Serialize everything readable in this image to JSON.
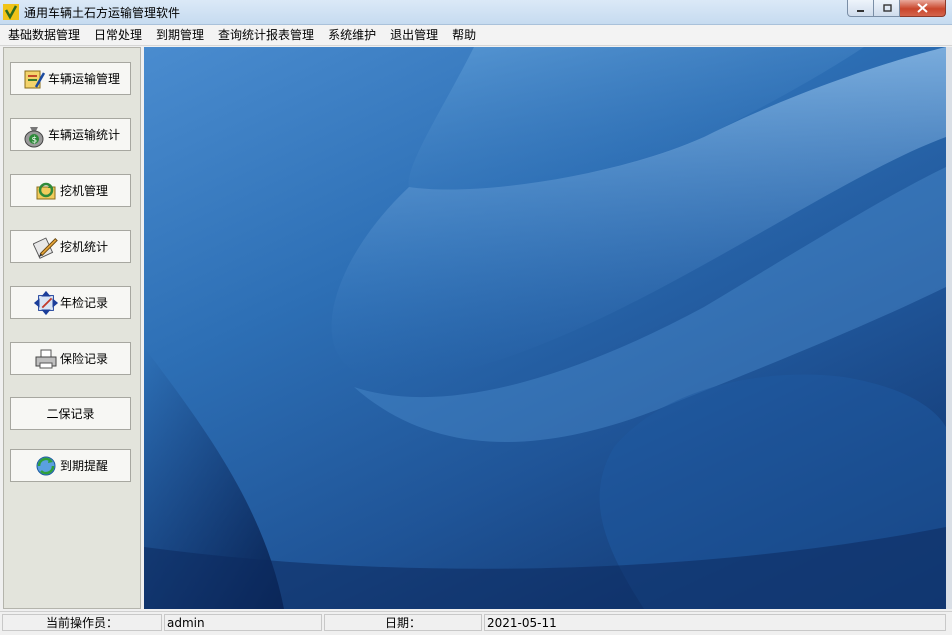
{
  "window": {
    "title": "通用车辆土石方运输管理软件"
  },
  "menubar": {
    "items": [
      "基础数据管理",
      "日常处理",
      "到期管理",
      "查询统计报表管理",
      "系统维护",
      "退出管理",
      "帮助"
    ]
  },
  "sidebar": {
    "buttons": [
      {
        "label": "车辆运输管理",
        "icon": "folder-edit-icon"
      },
      {
        "label": "车辆运输统计",
        "icon": "money-bag-icon"
      },
      {
        "label": "挖机管理",
        "icon": "refresh-folder-icon"
      },
      {
        "label": "挖机统计",
        "icon": "pencil-edit-icon"
      },
      {
        "label": "年检记录",
        "icon": "resize-arrows-icon"
      },
      {
        "label": "保险记录",
        "icon": "printer-icon"
      },
      {
        "label": "二保记录",
        "icon": ""
      },
      {
        "label": "到期提醒",
        "icon": "refresh-globe-icon"
      }
    ]
  },
  "statusbar": {
    "operator_label": "当前操作员：",
    "operator_value": "admin",
    "date_label": "日期：",
    "date_value": "2021-05-11"
  },
  "colors": {
    "desktop_blue": "#2d6fb5",
    "panel_bg": "#e3e4dc",
    "close_red": "#c9462c"
  }
}
